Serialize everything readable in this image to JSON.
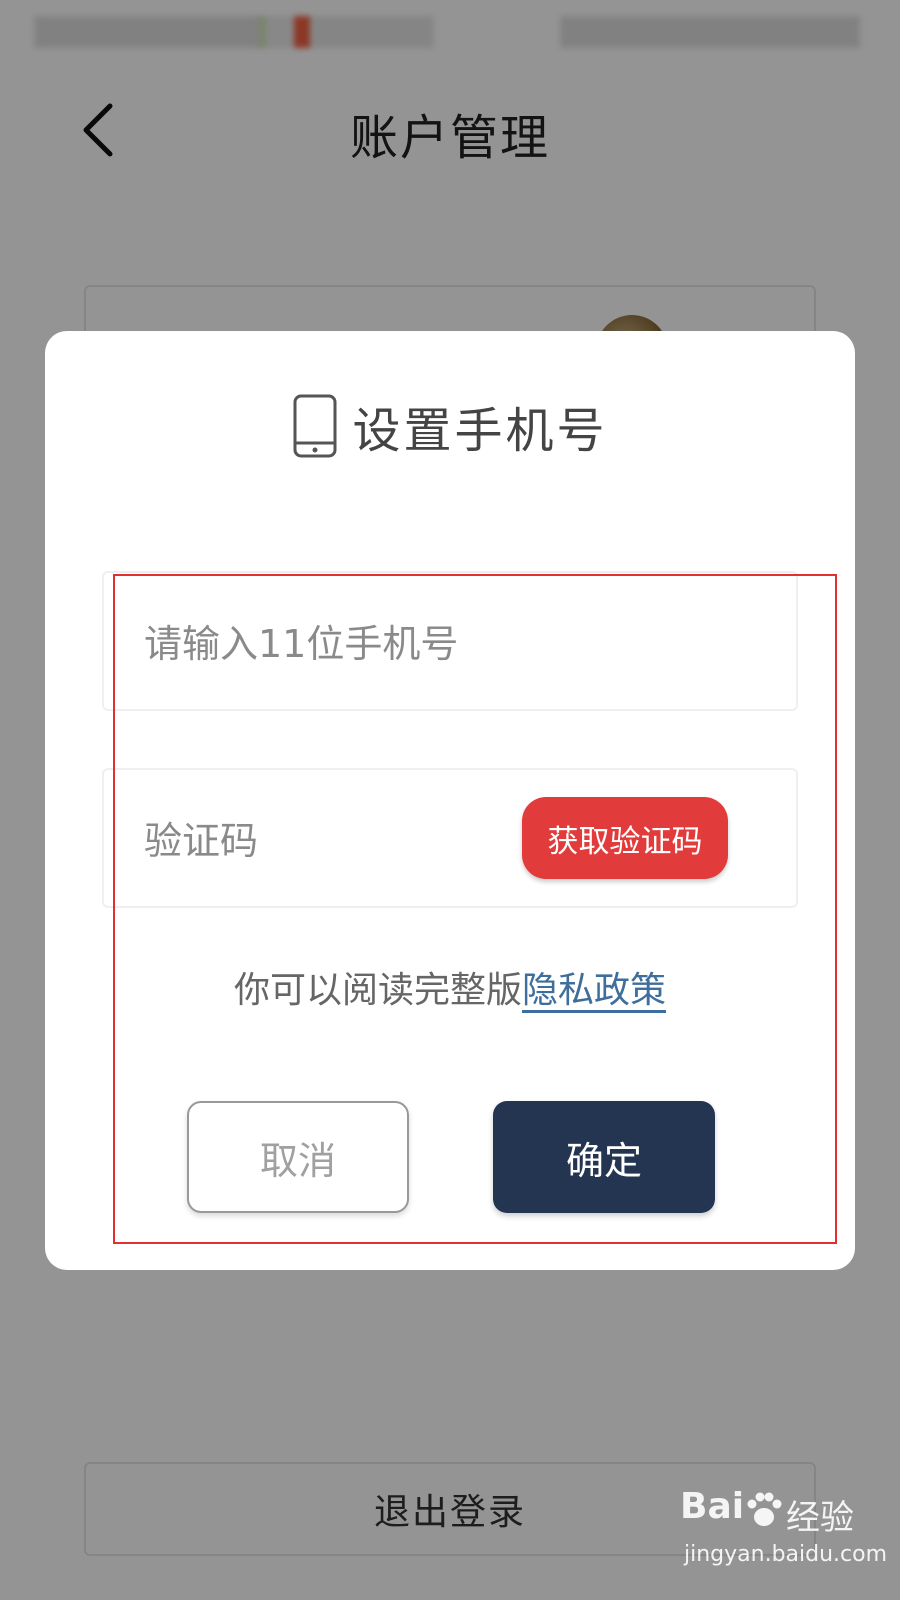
{
  "nav": {
    "title": "账户管理"
  },
  "account": {
    "logout_label": "退出登录"
  },
  "dialog": {
    "title": "设置手机号",
    "phone_placeholder": "请输入11位手机号",
    "code_placeholder": "验证码",
    "get_code_label": "获取验证码",
    "privacy_prefix": "你可以阅读完整版",
    "privacy_link": "隐私政策",
    "cancel_label": "取消",
    "confirm_label": "确定"
  },
  "icons": {
    "back": "chevron-left-icon",
    "phone": "smartphone-icon"
  },
  "colors": {
    "get_code_button": "#e23b3b",
    "confirm_button": "#243552",
    "privacy_link": "#3e6e9c",
    "highlight_frame": "#e03030"
  },
  "watermark": {
    "brand": "Bai",
    "cn": "经验",
    "url": "jingyan.baidu.com"
  }
}
